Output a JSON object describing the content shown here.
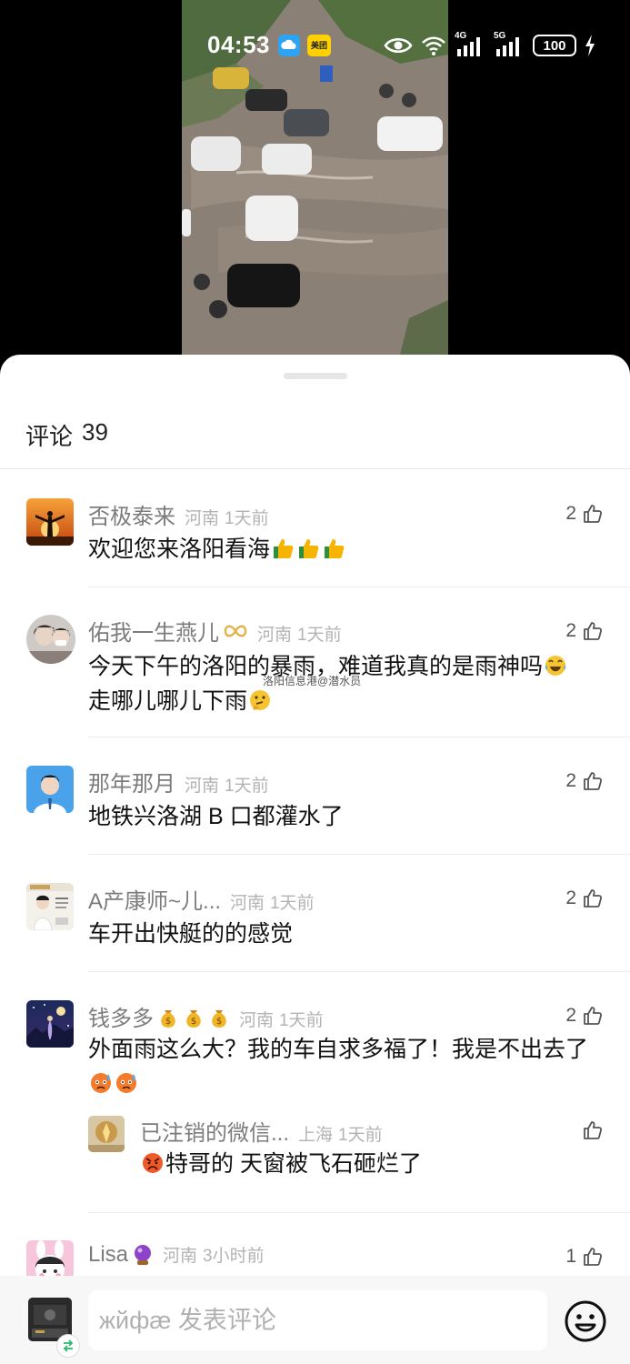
{
  "status_bar": {
    "time": "04:53",
    "network_4g": "4G",
    "network_5g": "5G",
    "battery": "100",
    "icons": [
      "cloud-app-icon",
      "meituan-app-icon",
      "eye-icon",
      "wifi-icon",
      "signal-4g-icon",
      "signal-5g-icon",
      "battery-icon",
      "charging-icon"
    ]
  },
  "meituan_badge": "美团",
  "sheet": {
    "title": "评论",
    "count": "39"
  },
  "watermark": "洛阳信息港@潜水员",
  "comments": [
    {
      "user": "否极泰来",
      "location": "河南",
      "time": "1天前",
      "likes": "2",
      "text": "欢迎您来洛阳看海",
      "emojis": [
        "thumbs-up-icon",
        "thumbs-up-icon",
        "thumbs-up-icon"
      ]
    },
    {
      "user": "佑我一生燕儿",
      "user_badge": "infinity-icon",
      "location": "河南",
      "time": "1天前",
      "likes": "2",
      "text_line1": "今天下午的洛阳的暴雨，难道我真的是雨神吗",
      "text_line2": "走哪儿哪儿下雨",
      "emojis": [
        "laugh-cry-icon",
        "thinking-face-icon"
      ]
    },
    {
      "user": "那年那月",
      "location": "河南",
      "time": "1天前",
      "likes": "2",
      "text": "地铁兴洛湖 B 口都灌水了"
    },
    {
      "user": "A产康师~儿...",
      "location": "河南",
      "time": "1天前",
      "likes": "2",
      "text": "车开出快艇的的感觉"
    },
    {
      "user": "钱多多",
      "user_badges": [
        "money-bag-icon",
        "money-bag-icon",
        "money-bag-icon"
      ],
      "location": "河南",
      "time": "1天前",
      "likes": "2",
      "text": "外面雨这么大？我的车自求多福了！我是不出去了",
      "emojis": [
        "sweat-face-icon",
        "sweat-face-icon"
      ],
      "reply": {
        "user": "已注销的微信...",
        "location": "上海",
        "time": "1天前",
        "text": "特哥的 天窗被飞石砸烂了",
        "emoji": "angry-face-icon"
      }
    },
    {
      "user": "Lisa",
      "user_badge": "crystal-ball-icon",
      "location": "河南",
      "time": "3小时前",
      "likes": "1"
    }
  ],
  "input": {
    "placeholder": "жйфæ 发表评论"
  },
  "colors": {
    "sheet_bg": "#ffffff",
    "name": "#7c7c7c",
    "meta": "#b3b3b3",
    "body": "#111111",
    "input_bar": "#f7f7f7",
    "thumb_emoji": "#f5b400"
  }
}
